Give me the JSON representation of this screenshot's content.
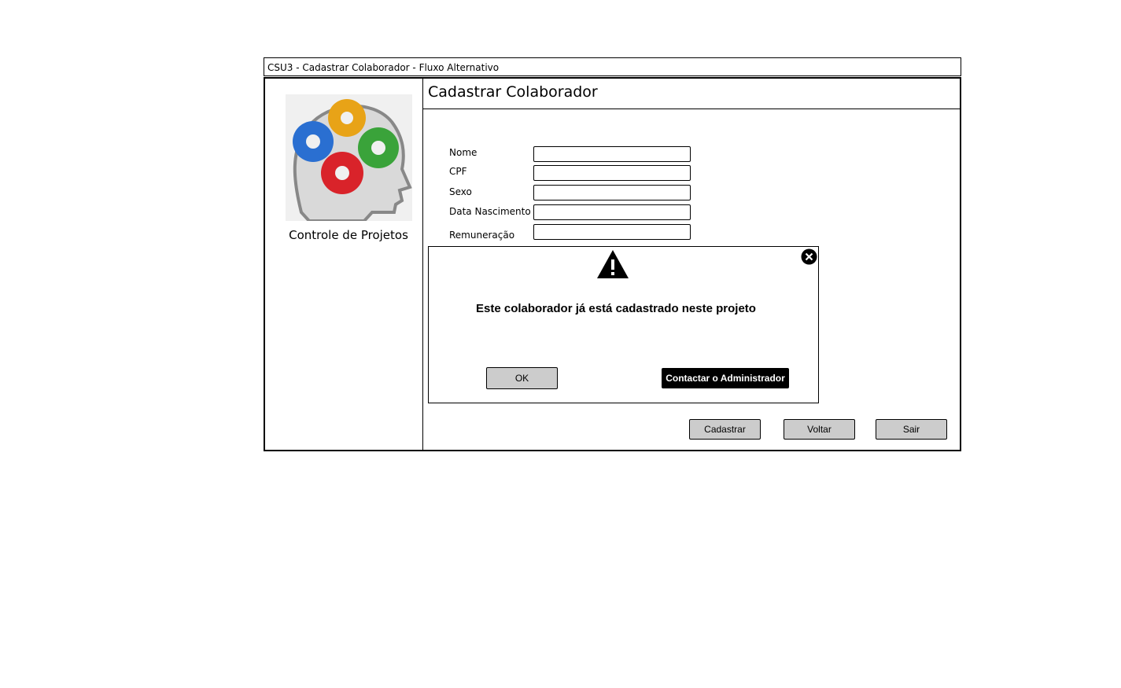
{
  "window": {
    "title": "CSU3 - Cadastrar Colaborador - Fluxo Alternativo"
  },
  "sidebar": {
    "logo_icon": "gears-head-logo-icon",
    "caption": "Controle de Projetos"
  },
  "content": {
    "title": "Cadastrar Colaborador",
    "fields": [
      {
        "label": "Nome",
        "value": ""
      },
      {
        "label": "CPF",
        "value": ""
      },
      {
        "label": "Sexo",
        "value": ""
      },
      {
        "label": "Data Nascimento",
        "value": ""
      },
      {
        "label": "Remuneração",
        "value": ""
      }
    ],
    "buttons": {
      "register": "Cadastrar",
      "back": "Voltar",
      "exit": "Sair"
    }
  },
  "dialog": {
    "icon": "warning-icon",
    "message": "Este colaborador já está cadastrado neste projeto",
    "ok_label": "OK",
    "contact_label": "Contactar o Administrador",
    "close_icon": "close-icon"
  },
  "colors": {
    "button_gray": "#cccccc",
    "primary_button": "#000000"
  }
}
